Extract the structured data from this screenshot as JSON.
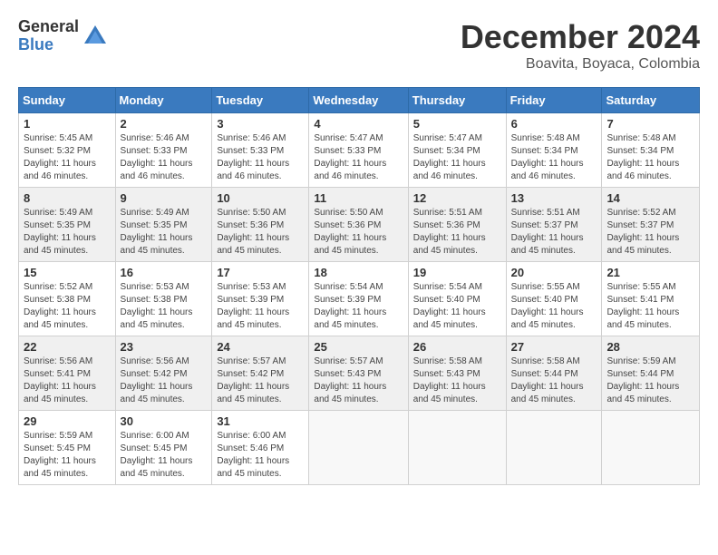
{
  "logo": {
    "general": "General",
    "blue": "Blue"
  },
  "title": "December 2024",
  "subtitle": "Boavita, Boyaca, Colombia",
  "days_of_week": [
    "Sunday",
    "Monday",
    "Tuesday",
    "Wednesday",
    "Thursday",
    "Friday",
    "Saturday"
  ],
  "weeks": [
    [
      {
        "day": 1,
        "sunrise": "5:45 AM",
        "sunset": "5:32 PM",
        "daylight": "11 hours and 46 minutes."
      },
      {
        "day": 2,
        "sunrise": "5:46 AM",
        "sunset": "5:33 PM",
        "daylight": "11 hours and 46 minutes."
      },
      {
        "day": 3,
        "sunrise": "5:46 AM",
        "sunset": "5:33 PM",
        "daylight": "11 hours and 46 minutes."
      },
      {
        "day": 4,
        "sunrise": "5:47 AM",
        "sunset": "5:33 PM",
        "daylight": "11 hours and 46 minutes."
      },
      {
        "day": 5,
        "sunrise": "5:47 AM",
        "sunset": "5:34 PM",
        "daylight": "11 hours and 46 minutes."
      },
      {
        "day": 6,
        "sunrise": "5:48 AM",
        "sunset": "5:34 PM",
        "daylight": "11 hours and 46 minutes."
      },
      {
        "day": 7,
        "sunrise": "5:48 AM",
        "sunset": "5:34 PM",
        "daylight": "11 hours and 46 minutes."
      }
    ],
    [
      {
        "day": 8,
        "sunrise": "5:49 AM",
        "sunset": "5:35 PM",
        "daylight": "11 hours and 45 minutes."
      },
      {
        "day": 9,
        "sunrise": "5:49 AM",
        "sunset": "5:35 PM",
        "daylight": "11 hours and 45 minutes."
      },
      {
        "day": 10,
        "sunrise": "5:50 AM",
        "sunset": "5:36 PM",
        "daylight": "11 hours and 45 minutes."
      },
      {
        "day": 11,
        "sunrise": "5:50 AM",
        "sunset": "5:36 PM",
        "daylight": "11 hours and 45 minutes."
      },
      {
        "day": 12,
        "sunrise": "5:51 AM",
        "sunset": "5:36 PM",
        "daylight": "11 hours and 45 minutes."
      },
      {
        "day": 13,
        "sunrise": "5:51 AM",
        "sunset": "5:37 PM",
        "daylight": "11 hours and 45 minutes."
      },
      {
        "day": 14,
        "sunrise": "5:52 AM",
        "sunset": "5:37 PM",
        "daylight": "11 hours and 45 minutes."
      }
    ],
    [
      {
        "day": 15,
        "sunrise": "5:52 AM",
        "sunset": "5:38 PM",
        "daylight": "11 hours and 45 minutes."
      },
      {
        "day": 16,
        "sunrise": "5:53 AM",
        "sunset": "5:38 PM",
        "daylight": "11 hours and 45 minutes."
      },
      {
        "day": 17,
        "sunrise": "5:53 AM",
        "sunset": "5:39 PM",
        "daylight": "11 hours and 45 minutes."
      },
      {
        "day": 18,
        "sunrise": "5:54 AM",
        "sunset": "5:39 PM",
        "daylight": "11 hours and 45 minutes."
      },
      {
        "day": 19,
        "sunrise": "5:54 AM",
        "sunset": "5:40 PM",
        "daylight": "11 hours and 45 minutes."
      },
      {
        "day": 20,
        "sunrise": "5:55 AM",
        "sunset": "5:40 PM",
        "daylight": "11 hours and 45 minutes."
      },
      {
        "day": 21,
        "sunrise": "5:55 AM",
        "sunset": "5:41 PM",
        "daylight": "11 hours and 45 minutes."
      }
    ],
    [
      {
        "day": 22,
        "sunrise": "5:56 AM",
        "sunset": "5:41 PM",
        "daylight": "11 hours and 45 minutes."
      },
      {
        "day": 23,
        "sunrise": "5:56 AM",
        "sunset": "5:42 PM",
        "daylight": "11 hours and 45 minutes."
      },
      {
        "day": 24,
        "sunrise": "5:57 AM",
        "sunset": "5:42 PM",
        "daylight": "11 hours and 45 minutes."
      },
      {
        "day": 25,
        "sunrise": "5:57 AM",
        "sunset": "5:43 PM",
        "daylight": "11 hours and 45 minutes."
      },
      {
        "day": 26,
        "sunrise": "5:58 AM",
        "sunset": "5:43 PM",
        "daylight": "11 hours and 45 minutes."
      },
      {
        "day": 27,
        "sunrise": "5:58 AM",
        "sunset": "5:44 PM",
        "daylight": "11 hours and 45 minutes."
      },
      {
        "day": 28,
        "sunrise": "5:59 AM",
        "sunset": "5:44 PM",
        "daylight": "11 hours and 45 minutes."
      }
    ],
    [
      {
        "day": 29,
        "sunrise": "5:59 AM",
        "sunset": "5:45 PM",
        "daylight": "11 hours and 45 minutes."
      },
      {
        "day": 30,
        "sunrise": "6:00 AM",
        "sunset": "5:45 PM",
        "daylight": "11 hours and 45 minutes."
      },
      {
        "day": 31,
        "sunrise": "6:00 AM",
        "sunset": "5:46 PM",
        "daylight": "11 hours and 45 minutes."
      },
      null,
      null,
      null,
      null
    ]
  ]
}
